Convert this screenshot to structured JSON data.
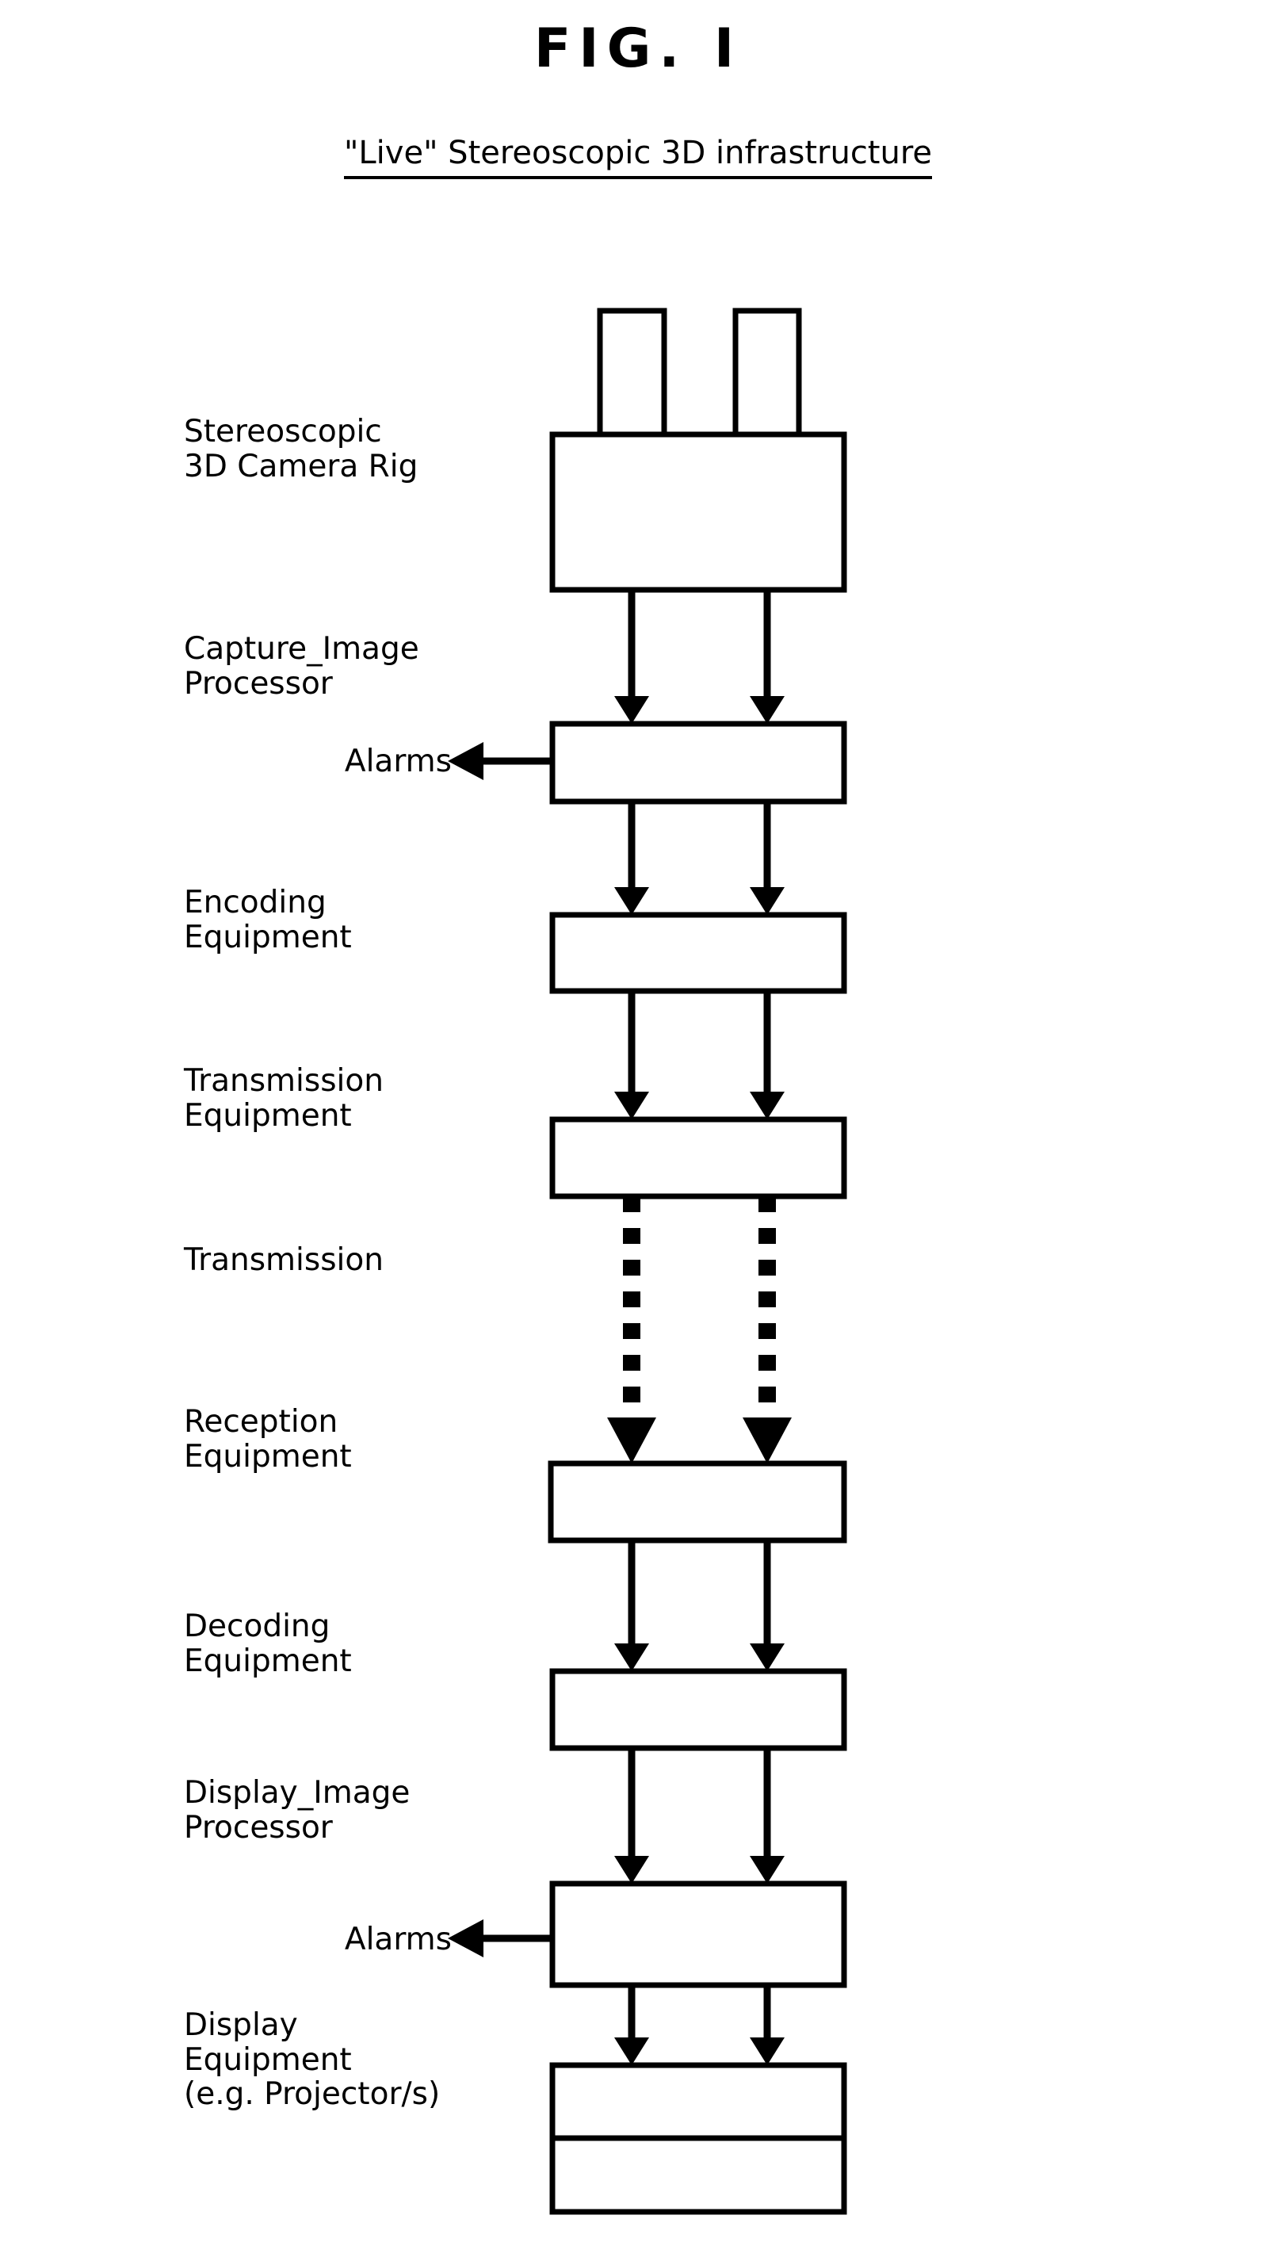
{
  "figure": {
    "title": "FIG. I",
    "subtitle": "\"Live\" Stereoscopic 3D infrastructure"
  },
  "stages": [
    {
      "id": "camera-rig",
      "label_line1": "Stereoscopic",
      "label_line2": "3D Camera Rig",
      "label_line3": ""
    },
    {
      "id": "capture-image-processor",
      "label_line1": "Capture_Image",
      "label_line2": "Processor",
      "label_line3": ""
    },
    {
      "id": "encoding-equipment",
      "label_line1": "Encoding",
      "label_line2": "Equipment",
      "label_line3": ""
    },
    {
      "id": "transmission-equipment",
      "label_line1": "Transmission",
      "label_line2": "Equipment",
      "label_line3": ""
    },
    {
      "id": "transmission",
      "label_line1": "Transmission",
      "label_line2": "",
      "label_line3": ""
    },
    {
      "id": "reception-equipment",
      "label_line1": "Reception",
      "label_line2": "Equipment",
      "label_line3": ""
    },
    {
      "id": "decoding-equipment",
      "label_line1": "Decoding",
      "label_line2": "Equipment",
      "label_line3": ""
    },
    {
      "id": "display-image-processor",
      "label_line1": "Display_Image",
      "label_line2": "Processor",
      "label_line3": ""
    },
    {
      "id": "display-equipment",
      "label_line1": "Display",
      "label_line2": "Equipment",
      "label_line3": "(e.g. Projector/s)"
    }
  ],
  "alarms": {
    "capture_label": "Alarms",
    "display_label": "Alarms"
  },
  "colors": {
    "stroke": "#000000",
    "fill": "#ffffff",
    "background": "#ffffff"
  }
}
